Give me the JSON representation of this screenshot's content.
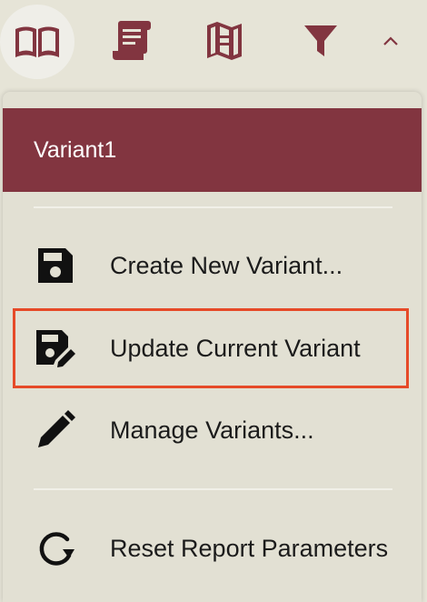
{
  "toolbar": {
    "buttons": [
      {
        "icon": "book-open-icon"
      },
      {
        "icon": "scroll-icon"
      },
      {
        "icon": "map-icon"
      },
      {
        "icon": "filter-icon"
      },
      {
        "icon": "chevron-up-icon"
      }
    ],
    "accent_color": "#823540"
  },
  "menu": {
    "header_label": "Variant1",
    "header_color": "#823540",
    "items": [
      {
        "label": "Create New Variant...",
        "icon": "save-icon"
      },
      {
        "label": "Update Current Variant",
        "icon": "save-edit-icon",
        "highlight_color": "#e64a28"
      },
      {
        "label": "Manage Variants...",
        "icon": "pencil-icon"
      },
      {
        "label": "Reset Report Parameters",
        "icon": "reset-icon"
      }
    ]
  }
}
